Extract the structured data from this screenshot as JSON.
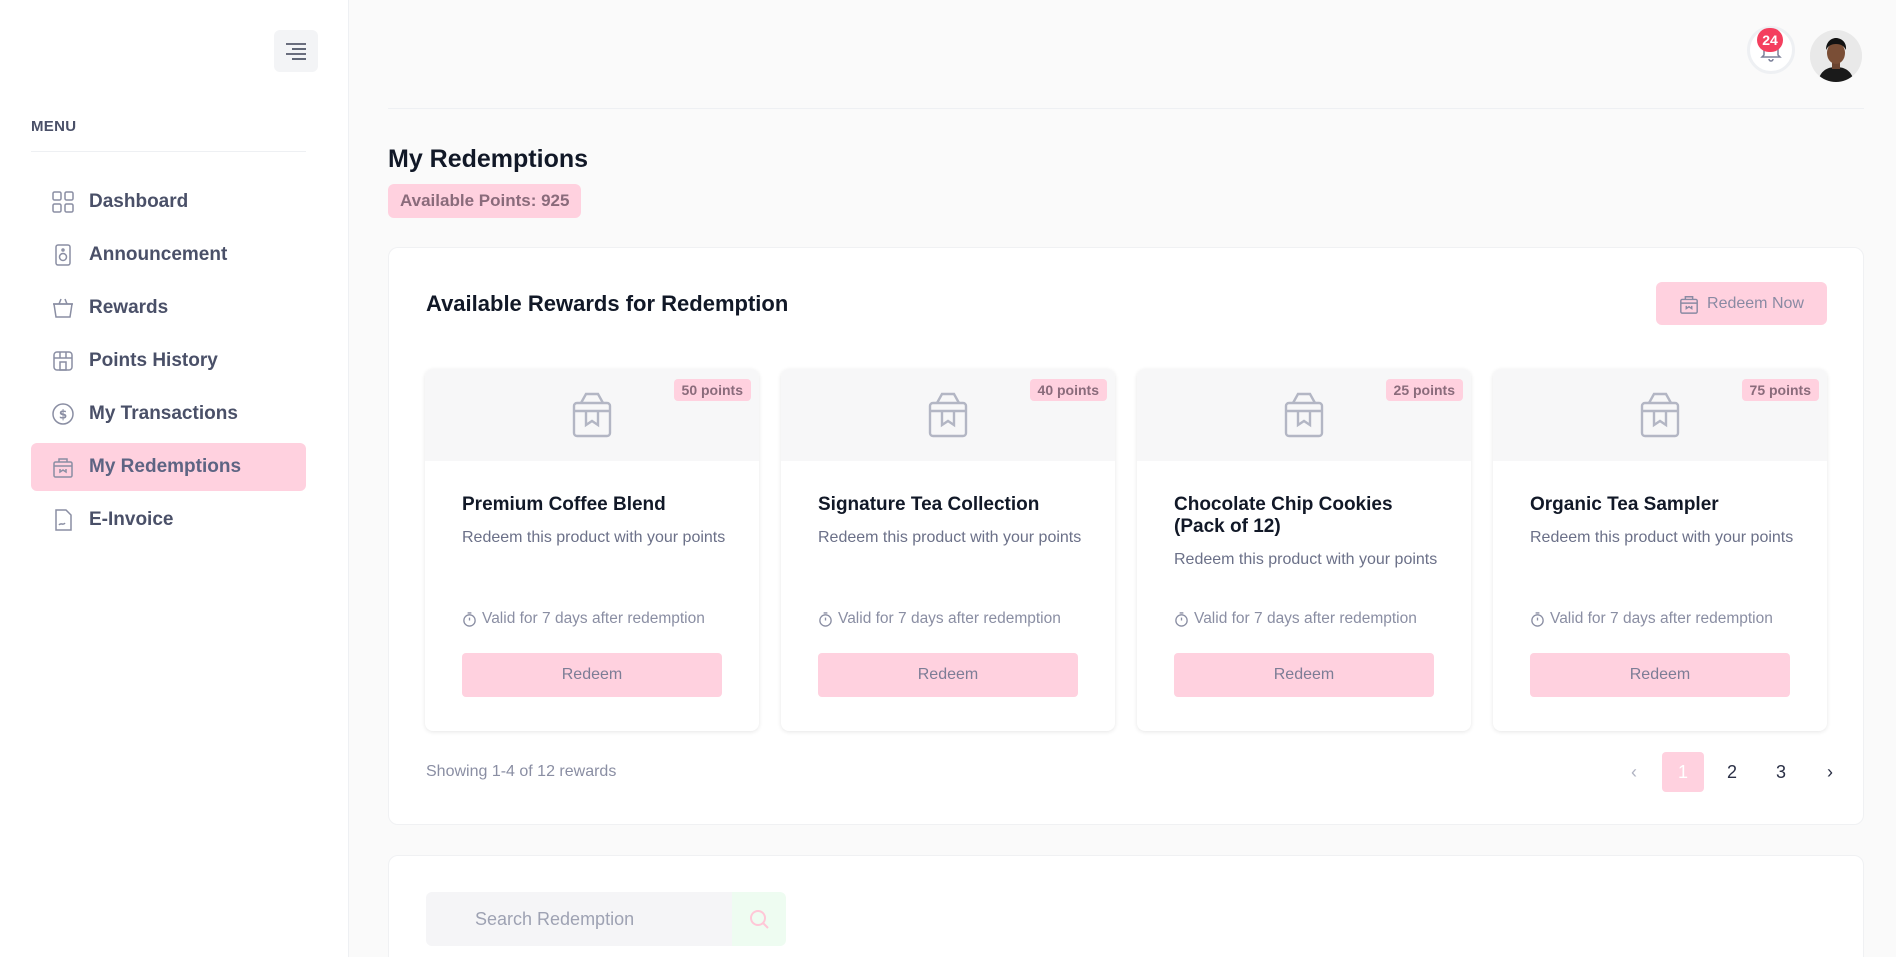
{
  "sidebar": {
    "menu_label": "MENU",
    "items": [
      {
        "label": "Dashboard",
        "icon": "grid-icon",
        "active": false
      },
      {
        "label": "Announcement",
        "icon": "speaker-icon",
        "active": false
      },
      {
        "label": "Rewards",
        "icon": "basket-icon",
        "active": false
      },
      {
        "label": "Points History",
        "icon": "store-icon",
        "active": false
      },
      {
        "label": "My Transactions",
        "icon": "dollar-circle-icon",
        "active": false
      },
      {
        "label": "My Redemptions",
        "icon": "shopping-bag-icon",
        "active": true
      },
      {
        "label": "E-Invoice",
        "icon": "document-icon",
        "active": false
      }
    ]
  },
  "header": {
    "notification_count": "24"
  },
  "page": {
    "title": "My Redemptions",
    "available_points": "Available Points: 925"
  },
  "rewards_panel": {
    "title": "Available Rewards for Redemption",
    "redeem_now_label": "Redeem Now",
    "rewards": [
      {
        "points": "50 points",
        "name": "Premium Coffee Blend",
        "description": "Redeem this product with your points",
        "validity": "Valid for 7 days after redemption",
        "button": "Redeem"
      },
      {
        "points": "40 points",
        "name": "Signature Tea Collection",
        "description": "Redeem this product with your points",
        "validity": "Valid for 7 days after redemption",
        "button": "Redeem"
      },
      {
        "points": "25 points",
        "name": "Chocolate Chip Cookies (Pack of 12)",
        "description": "Redeem this product with your points",
        "validity": "Valid for 7 days after redemption",
        "button": "Redeem"
      },
      {
        "points": "75 points",
        "name": "Organic Tea Sampler",
        "description": "Redeem this product with your points",
        "validity": "Valid for 7 days after redemption",
        "button": "Redeem"
      }
    ],
    "showing_text": "Showing 1-4 of 12 rewards",
    "pagination": {
      "prev": "‹",
      "pages": [
        "1",
        "2",
        "3"
      ],
      "current": "1",
      "next": "›"
    }
  },
  "search": {
    "placeholder": "Search Redemption"
  },
  "colors": {
    "accent_pink": "#ffd1df",
    "badge_red": "#f43f5e"
  }
}
